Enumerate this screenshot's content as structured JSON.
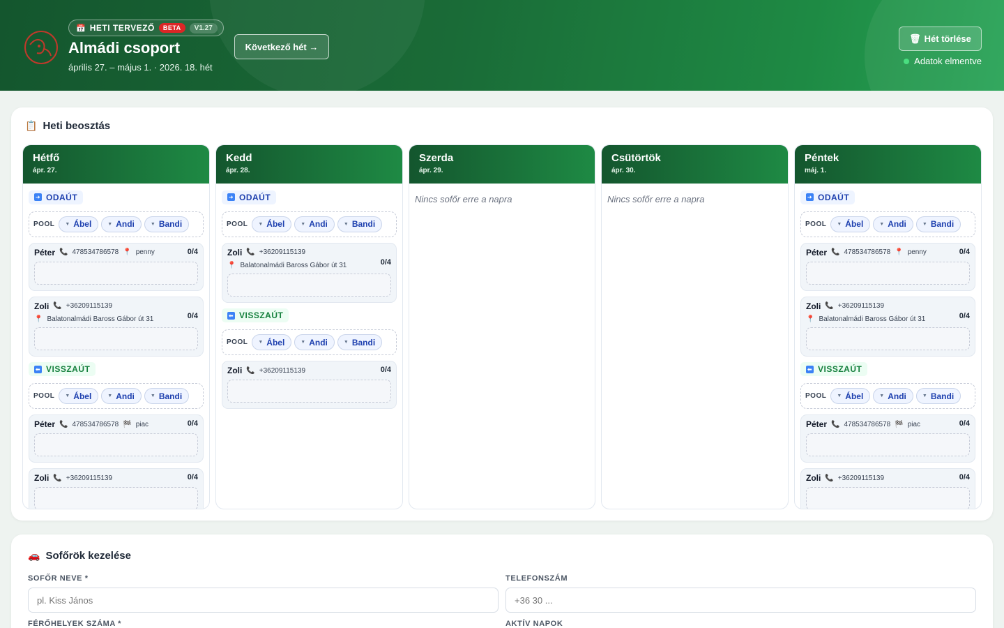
{
  "header": {
    "badge_icon": "calendar-icon",
    "badge_label": "HETI TERVEZŐ",
    "beta": "BETA",
    "version": "V1.27",
    "title": "Almádi csoport",
    "subtitle": "április 27. – május 1. · 2026. 18. hét",
    "next_week": "Következő hét →",
    "clear_week": "Hét törlése",
    "saved_status": "Adatok elmentve"
  },
  "week": {
    "title": "Heti beosztás",
    "out_label": "ODAÚT",
    "back_label": "VISSZAÚT",
    "pool_label": "POOL",
    "empty_msg": "Nincs sofőr erre a napra",
    "pool_chips": [
      "Ábel",
      "Andi",
      "Bandi"
    ],
    "days": [
      {
        "name": "Hétfő",
        "date": "ápr. 27."
      },
      {
        "name": "Kedd",
        "date": "ápr. 28."
      },
      {
        "name": "Szerda",
        "date": "ápr. 29."
      },
      {
        "name": "Csütörtök",
        "date": "ápr. 30."
      },
      {
        "name": "Péntek",
        "date": "máj. 1."
      }
    ],
    "drivers": {
      "peter": {
        "name": "Péter",
        "phone": "478534786578",
        "place_out": "penny",
        "place_back": "piac",
        "cap": "0/4"
      },
      "zoli": {
        "name": "Zoli",
        "phone": "+36209115139",
        "address": "Balatonalmádi Baross Gábor út 31",
        "cap": "0/4"
      }
    }
  },
  "drivers_form": {
    "title": "Sofőrök kezelése",
    "name_label": "SOFŐR NEVE *",
    "name_placeholder": "pl. Kiss János",
    "phone_label": "TELEFONSZÁM",
    "phone_placeholder": "+36 30 ...",
    "seats_label": "FÉRŐHELYEK SZÁMA *",
    "days_label": "AKTÍV NAPOK"
  },
  "colors": {
    "header_dark": "#14562e",
    "header_light": "#27a355",
    "beta": "#dc2626",
    "chip_text": "#1e40af",
    "phone_icon": "#e11d48"
  }
}
